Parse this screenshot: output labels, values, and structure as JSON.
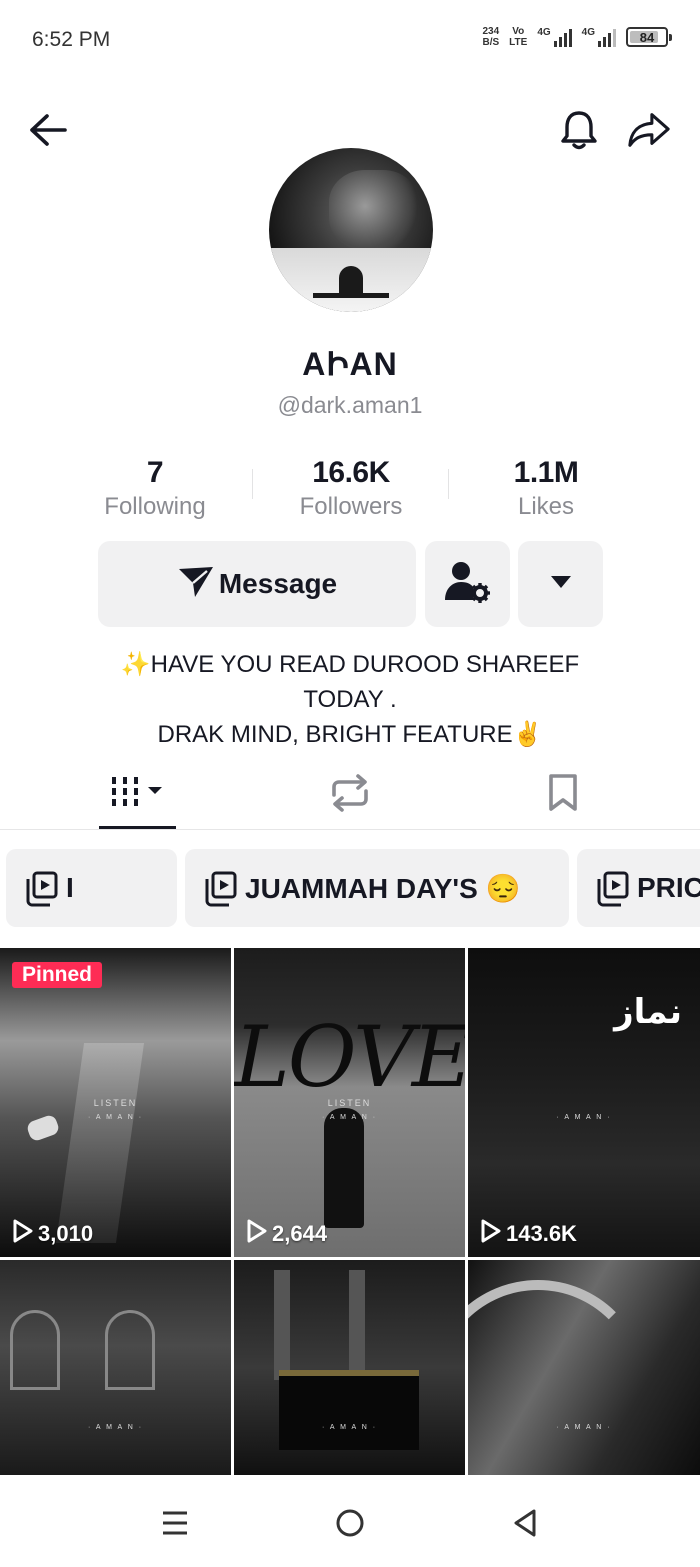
{
  "status_bar": {
    "time": "6:52 PM",
    "net_speed_value": "234",
    "net_speed_unit": "B/S",
    "volte_top": "Vo",
    "volte_bottom": "LTE",
    "signal1_label": "4G",
    "signal2_label": "4G",
    "battery": "84",
    "battery_level": 0.84
  },
  "topbar": {
    "back_icon": "arrow-left-icon",
    "bell_icon": "bell-icon",
    "share_icon": "share-arrow-icon"
  },
  "profile": {
    "display_name": "AԻAN",
    "handle": "@dark.aman1"
  },
  "stats": [
    {
      "value": "7",
      "label": "Following"
    },
    {
      "value": "16.6K",
      "label": "Followers"
    },
    {
      "value": "1.1M",
      "label": "Likes"
    }
  ],
  "actions": {
    "message_label": "Message",
    "message_icon": "send-icon",
    "user_settings_icon": "user-gear-icon",
    "more_icon": "caret-down-icon"
  },
  "bio": {
    "line1": "✨HAVE YOU READ DUROOD SHAREEF",
    "line2": "TODAY .",
    "line3": "DRAK MIND, BRIGHT FEATURE✌️"
  },
  "tabs": {
    "videos_icon": "grid-bars-icon",
    "reposts_icon": "repost-icon",
    "favorites_icon": "bookmark-icon"
  },
  "playlists": [
    {
      "label": "I"
    },
    {
      "label": "JUAMMAH DAY'S 😔"
    },
    {
      "label": "PRIC"
    }
  ],
  "videos": [
    {
      "views": "3,010",
      "pinned_label": "Pinned",
      "overlay": "LISTEN",
      "overlay2": "· A M A N ·"
    },
    {
      "views": "2,644",
      "overlay": "LISTEN",
      "overlay2": "· A M A N ·",
      "big_text": "LOVE"
    },
    {
      "views": "143.6K",
      "arabic": "نماز",
      "overlay2": "· A M A N ·"
    },
    {
      "views": "",
      "overlay2": "· A M A N ·"
    },
    {
      "views": "",
      "overlay2": "· A M A N ·"
    },
    {
      "views": "",
      "overlay2": "· A M A N ·"
    }
  ],
  "colors": {
    "accent": "#fe2c55",
    "text": "#161823",
    "secondary_text": "#8a8b91",
    "button_bg": "#f1f1f2"
  },
  "nav": {
    "menu_icon": "menu-lines-icon",
    "home_icon": "circle-home-icon",
    "back_icon": "triangle-back-icon"
  }
}
